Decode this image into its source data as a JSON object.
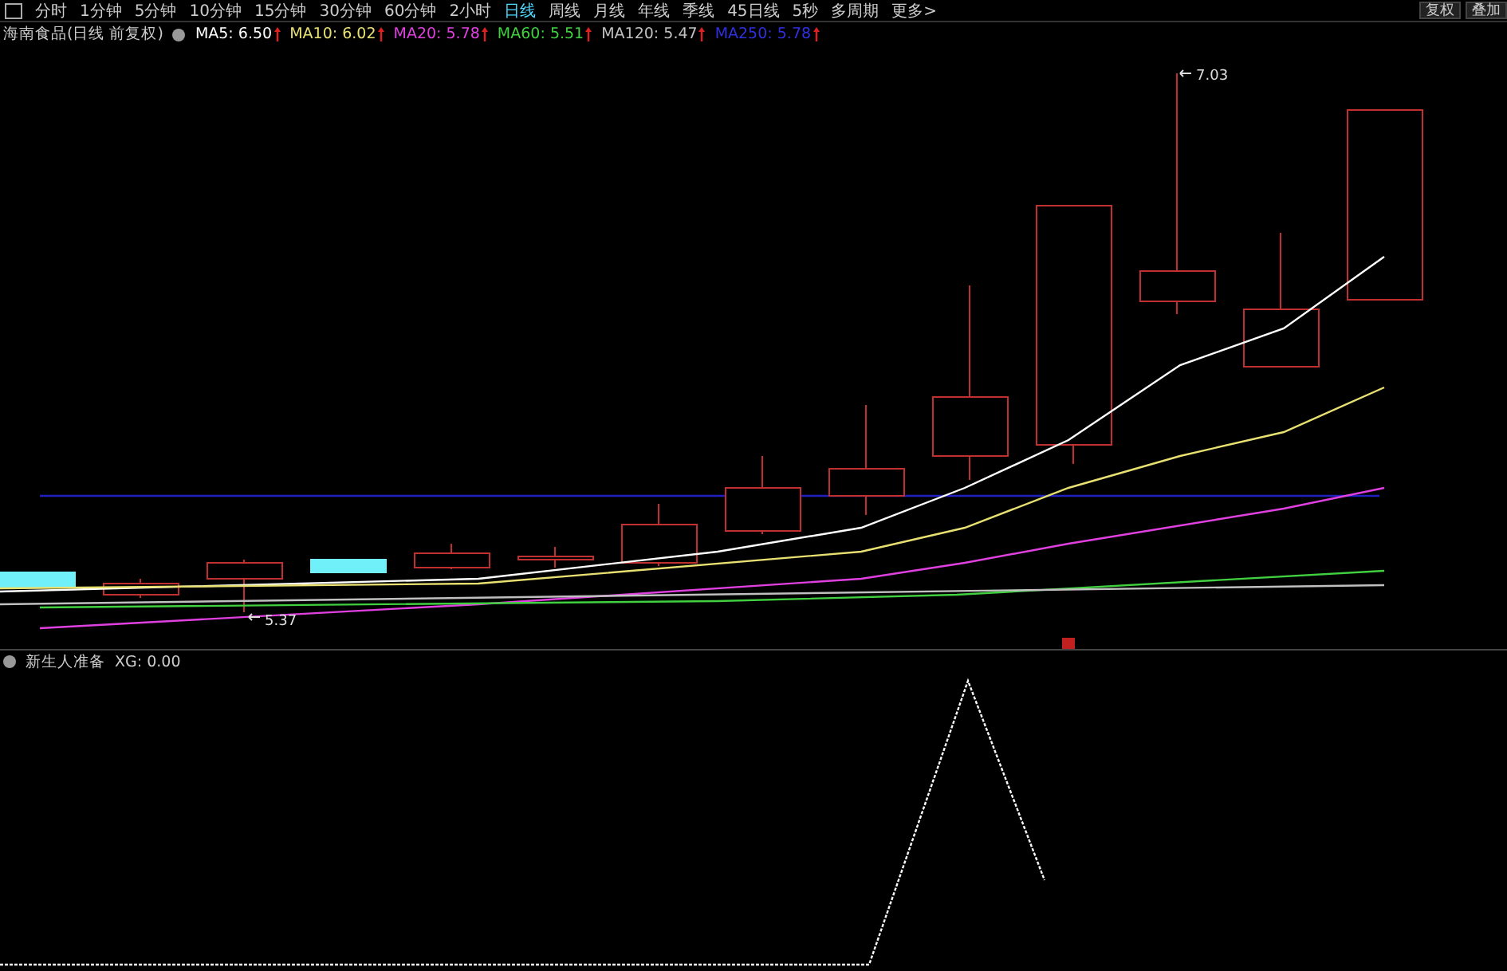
{
  "toolbar": {
    "periods": [
      {
        "label": "分时",
        "selected": false
      },
      {
        "label": "1分钟",
        "selected": false
      },
      {
        "label": "5分钟",
        "selected": false
      },
      {
        "label": "10分钟",
        "selected": false
      },
      {
        "label": "15分钟",
        "selected": false
      },
      {
        "label": "30分钟",
        "selected": false
      },
      {
        "label": "60分钟",
        "selected": false
      },
      {
        "label": "2小时",
        "selected": false
      },
      {
        "label": "日线",
        "selected": true
      },
      {
        "label": "周线",
        "selected": false
      },
      {
        "label": "月线",
        "selected": false
      },
      {
        "label": "年线",
        "selected": false
      },
      {
        "label": "季线",
        "selected": false
      },
      {
        "label": "45日线",
        "selected": false
      },
      {
        "label": "5秒",
        "selected": false
      },
      {
        "label": "多周期",
        "selected": false
      },
      {
        "label": "更多>",
        "selected": false
      }
    ],
    "right_buttons": [
      "复权",
      "叠加"
    ]
  },
  "price_legend": {
    "title": "海南食品(日线 前复权)",
    "averages": [
      {
        "label": "MA5:",
        "value": "6.50",
        "color": "#ffffff"
      },
      {
        "label": "MA10:",
        "value": "6.02",
        "color": "#e8e070"
      },
      {
        "label": "MA20:",
        "value": "5.78",
        "color": "#e040e0"
      },
      {
        "label": "MA60:",
        "value": "5.51",
        "color": "#40d040"
      },
      {
        "label": "MA120:",
        "value": "5.47",
        "color": "#c0c0c0"
      },
      {
        "label": "MA250:",
        "value": "5.78",
        "color": "#3030e0"
      }
    ]
  },
  "price_chart": {
    "high_label": "7.03",
    "low_label": "5.37"
  },
  "indicator_legend": {
    "title": "新生人准备",
    "label": "XG:",
    "value": "0.00"
  }
}
